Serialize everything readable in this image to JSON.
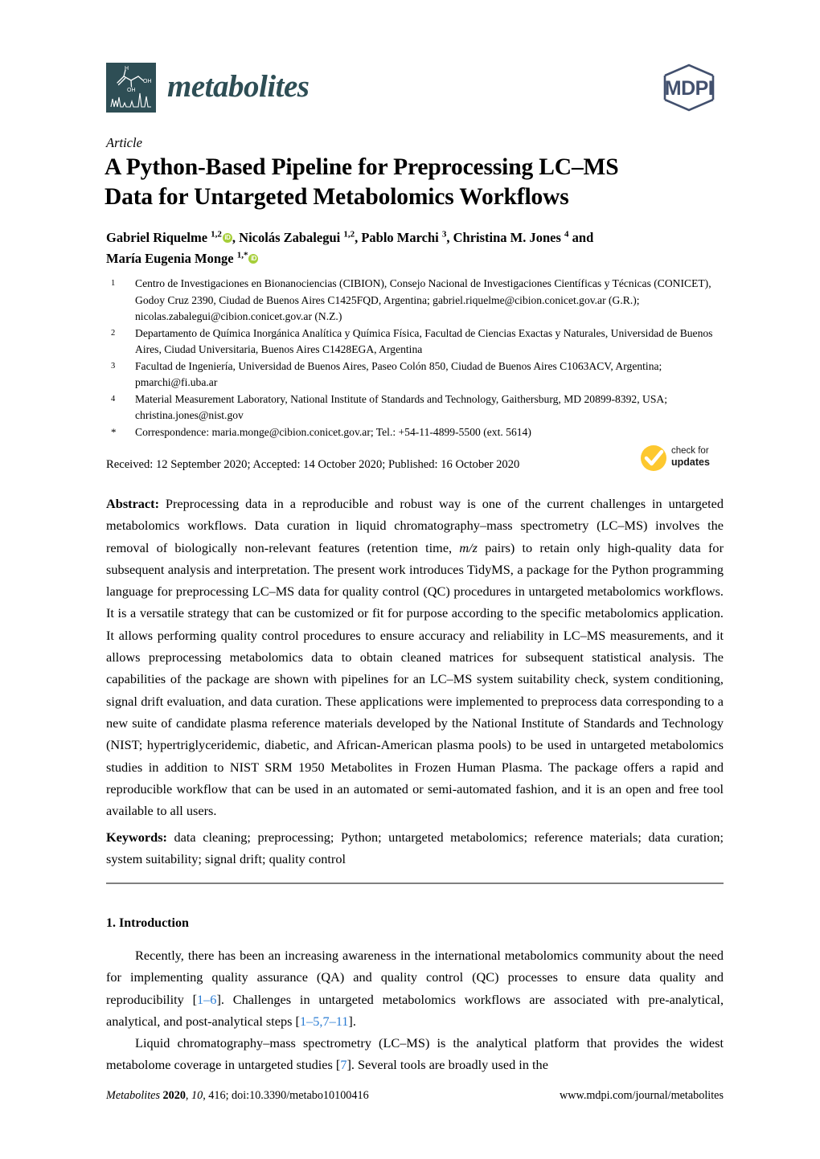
{
  "journal": {
    "name": "metabolites",
    "logo_bg": "#2e4e55",
    "publisher": "MDPI"
  },
  "article_type": "Article",
  "title": "A Python-Based Pipeline for Preprocessing LC–MS Data for Untargeted Metabolomics Workflows",
  "title_line1": "A Python-Based Pipeline for Preprocessing LC–MS",
  "title_line2": "Data for Untargeted Metabolomics Workflows",
  "authors_line1_a": "Gabriel Riquelme ",
  "authors_sup1": "1,2",
  "authors_line1_b": ", Nicolás Zabalegui ",
  "authors_sup2": "1,2",
  "authors_line1_c": ", Pablo Marchi ",
  "authors_sup3": "3",
  "authors_line1_d": ", Christina M. Jones ",
  "authors_sup4": "4",
  "authors_line1_e": " and",
  "authors_line2_a": "María Eugenia Monge ",
  "authors_sup5": "1,*",
  "orcid_label": "iD",
  "affiliations": [
    {
      "marker": "1",
      "text": "Centro de Investigaciones en Bionanociencias (CIBION), Consejo Nacional de Investigaciones Científicas y Técnicas (CONICET), Godoy Cruz 2390, Ciudad de Buenos Aires C1425FQD, Argentina; gabriel.riquelme@cibion.conicet.gov.ar (G.R.); nicolas.zabalegui@cibion.conicet.gov.ar (N.Z.)"
    },
    {
      "marker": "2",
      "text": "Departamento de Química Inorgánica Analítica y Química Física, Facultad de Ciencias Exactas y Naturales, Universidad de Buenos Aires, Ciudad Universitaria, Buenos Aires C1428EGA, Argentina"
    },
    {
      "marker": "3",
      "text": "Facultad de Ingeniería, Universidad de Buenos Aires, Paseo Colón 850, Ciudad de Buenos Aires C1063ACV, Argentina; pmarchi@fi.uba.ar"
    },
    {
      "marker": "4",
      "text": "Material Measurement Laboratory, National Institute of Standards and Technology, Gaithersburg, MD 20899-8392, USA; christina.jones@nist.gov"
    },
    {
      "marker": "*",
      "text": "Correspondence: maria.monge@cibion.conicet.gov.ar; Tel.: +54-11-4899-5500 (ext. 5614)"
    }
  ],
  "dates_line": "Received: 12 September 2020; Accepted: 14 October 2020; Published: 16 October 2020",
  "crossmark": {
    "line1": "check for",
    "line2": "updates",
    "color": "#fdc82f"
  },
  "abstract": {
    "label": "Abstract:",
    "text_part1": " Preprocessing data in a reproducible and robust way is one of the current challenges in untargeted metabolomics workflows. Data curation in liquid chromatography–mass spectrometry (LC–MS) involves the removal of biologically non-relevant features (retention time, ",
    "italic1": "m/z",
    "text_part2": " pairs) to retain only high-quality data for subsequent analysis and interpretation. The present work introduces TidyMS, a package for the Python programming language for preprocessing LC–MS data for quality control (QC) procedures in untargeted metabolomics workflows. It is a versatile strategy that can be customized or fit for purpose according to the specific metabolomics application. It allows performing quality control procedures to ensure accuracy and reliability in LC–MS measurements, and it allows preprocessing metabolomics data to obtain cleaned matrices for subsequent statistical analysis. The capabilities of the package are shown with pipelines for an LC–MS system suitability check, system conditioning, signal drift evaluation, and data curation. These applications were implemented to preprocess data corresponding to a new suite of candidate plasma reference materials developed by the National Institute of Standards and Technology (NIST; hypertriglyceridemic, diabetic, and African-American plasma pools) to be used in untargeted metabolomics studies in addition to NIST SRM 1950 Metabolites in Frozen Human Plasma. The package offers a rapid and reproducible workflow that can be used in an automated or semi-automated fashion, and it is an open and free tool available to all users."
  },
  "keywords": {
    "label": "Keywords:",
    "text": " data cleaning; preprocessing; Python; untargeted metabolomics; reference materials; data curation; system suitability; signal drift; quality control"
  },
  "section_heading": "1. Introduction",
  "paragraph1": {
    "part1": "Recently, there has been an increasing awareness in the international metabolomics community about the need for implementing quality assurance (QA) and quality control (QC) processes to ensure data quality and reproducibility [",
    "cite1": "1–6",
    "part2": "]. Challenges in untargeted metabolomics workflows are associated with pre-analytical, analytical, and post-analytical steps [",
    "cite2": "1–5,7–11",
    "part3": "]."
  },
  "paragraph2": {
    "part1": "Liquid chromatography–mass spectrometry (LC–MS) is the analytical platform that provides the widest metabolome coverage in untargeted studies [",
    "cite1": "7",
    "part2": "]. Several tools are broadly used in the"
  },
  "footer": {
    "journal_italic": "Metabolites",
    "year": "2020",
    "volume": "10",
    "rest": ", 416; doi:10.3390/metabo10100416",
    "url": "www.mdpi.com/journal/metabolites"
  }
}
